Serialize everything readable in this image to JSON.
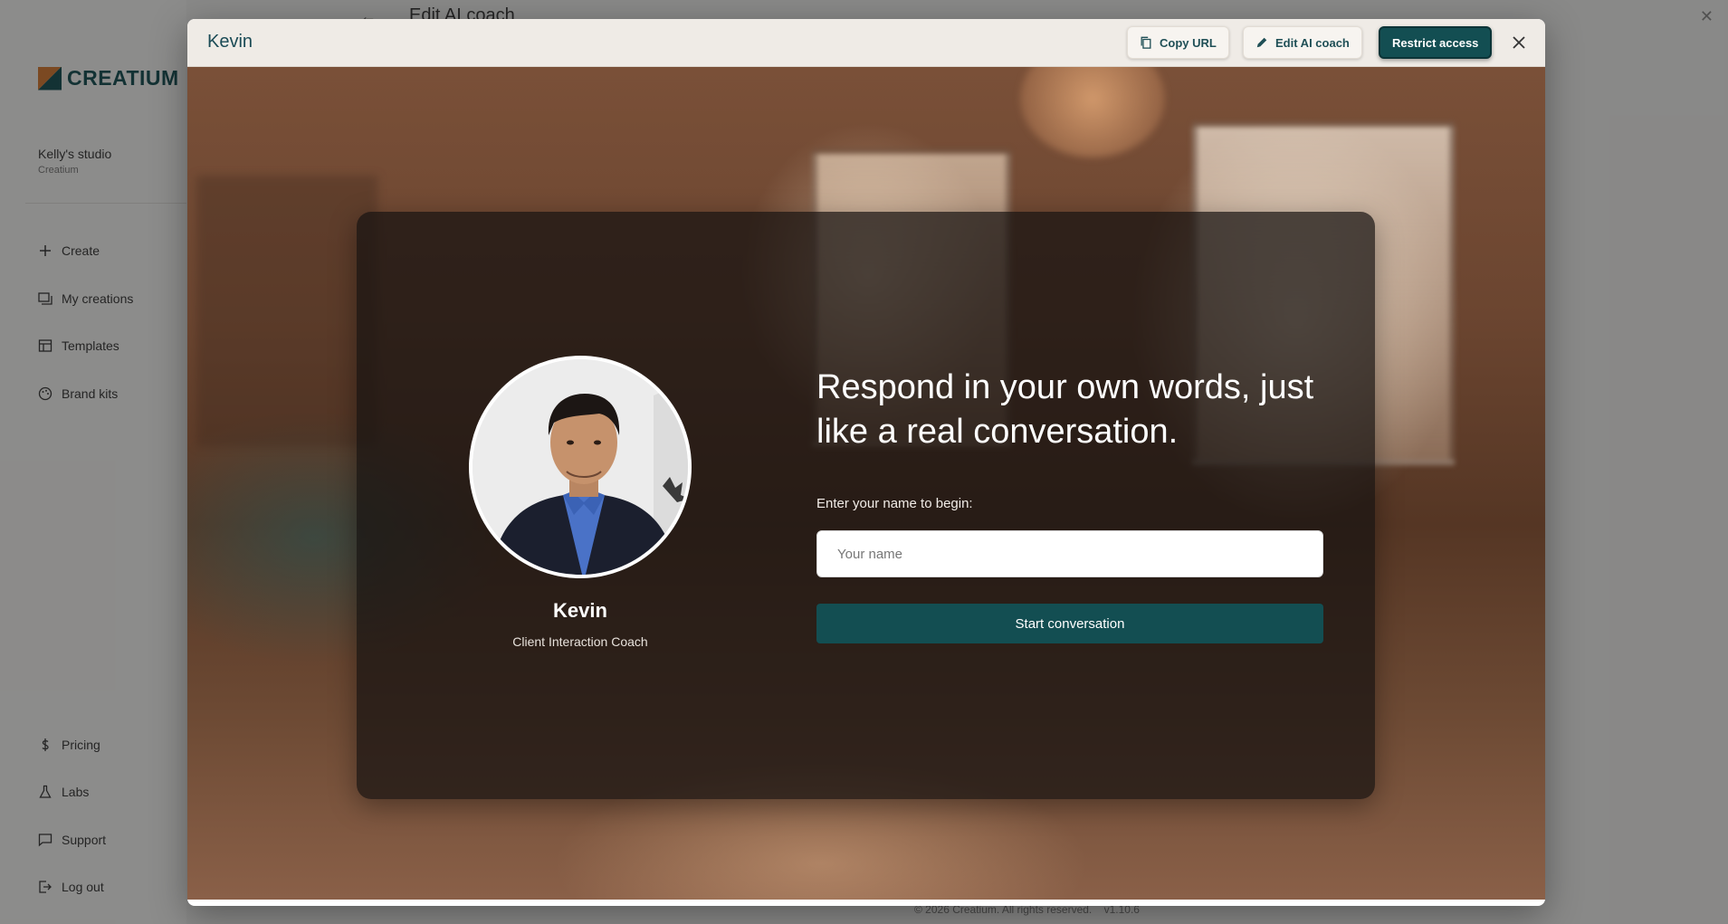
{
  "app": {
    "brand": "CREATIUM",
    "studio_name": "Kelly's studio",
    "studio_sub": "Creatium",
    "page_title": "Edit AI coach",
    "footer_copyright": "© 2026 Creatium. All rights reserved.",
    "footer_version": "v1.10.6"
  },
  "sidebar": {
    "top_items": [
      {
        "label": "Create",
        "icon": "plus-icon"
      },
      {
        "label": "My creations",
        "icon": "folders-icon"
      },
      {
        "label": "Templates",
        "icon": "layout-icon"
      },
      {
        "label": "Brand kits",
        "icon": "palette-icon"
      }
    ],
    "bottom_items": [
      {
        "label": "Pricing",
        "icon": "dollar-icon"
      },
      {
        "label": "Labs",
        "icon": "flask-icon"
      },
      {
        "label": "Support",
        "icon": "chat-icon"
      },
      {
        "label": "Log out",
        "icon": "logout-icon"
      }
    ]
  },
  "modal": {
    "title": "Kevin",
    "copy_url_label": "Copy URL",
    "edit_label": "Edit AI coach",
    "restrict_label": "Restrict access",
    "accent_color": "#134e52"
  },
  "coach": {
    "name": "Kevin",
    "role": "Client Interaction Coach"
  },
  "intro": {
    "headline": "Respond in your own words, just like a real conversation.",
    "name_label": "Enter your name to begin:",
    "name_placeholder": "Your name",
    "name_value": "",
    "start_label": "Start conversation"
  }
}
